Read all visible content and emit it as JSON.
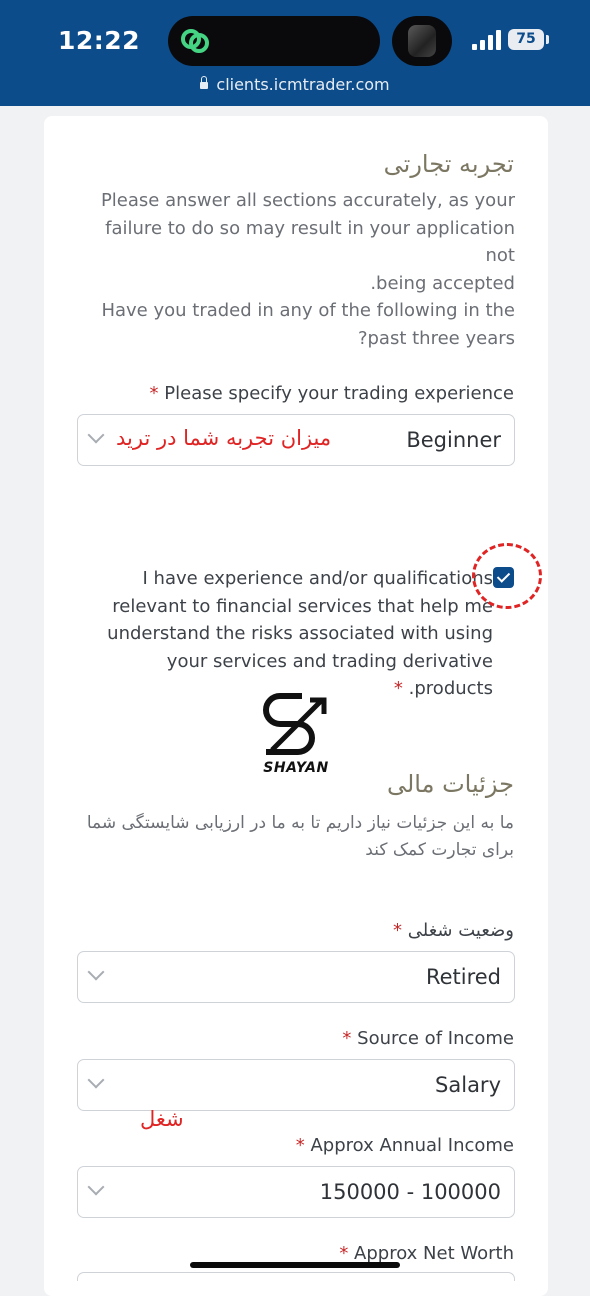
{
  "status": {
    "time": "12:22",
    "battery": "75"
  },
  "browser": {
    "url": "clients.icmtrader.com"
  },
  "trading": {
    "heading": "تجربه تجارتی",
    "intro_lines": [
      "Please answer all sections accurately, as your",
      "failure to do so may result in your application not",
      ".being accepted",
      "Have you traded in any of the following in the",
      "?past three years"
    ],
    "experience_label": "Please specify your trading experience",
    "experience_value": "Beginner",
    "experience_note": "میزان تجربه شما در ترید",
    "qualifications_lines": [
      "I have experience and/or qualifications",
      "relevant to financial services that help me",
      "understand the risks associated with using",
      "your services and trading derivative",
      ".products"
    ],
    "required_mark": "*"
  },
  "watermark": {
    "text": "SHAYAN"
  },
  "financial": {
    "heading": "جزئیات مالی",
    "intro_lines": [
      "ما به این جزئیات نیاز داریم تا به ما در ارزیابی شایستگی شما",
      "برای تجارت کمک کند"
    ],
    "employment_label": "وضعیت شغلی",
    "employment_value": "Retired",
    "income_source_label": "Source of Income",
    "income_source_value": "Salary",
    "job_note": "شغل",
    "annual_income_label": "Approx Annual Income",
    "annual_income_value": "150000 - 100000",
    "net_worth_label": "Approx Net Worth"
  },
  "colors": {
    "header_bg": "#0d4c8a",
    "required": "#c62828",
    "annotation": "#e02424",
    "checkbox": "#0d4c8a"
  }
}
